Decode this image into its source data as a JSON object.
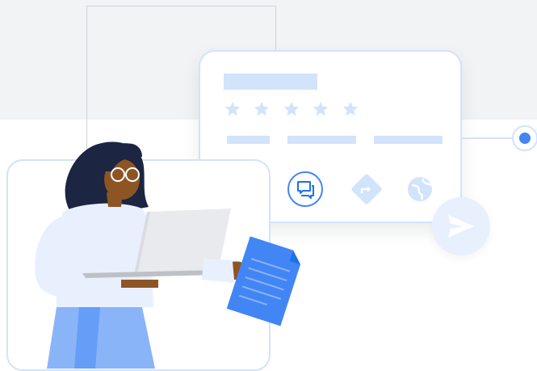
{
  "colors": {
    "accent": "#4285f4",
    "light_blue": "#d2e3fc",
    "pale_blue": "#e8f0fe",
    "background_band": "#f1f3f4"
  },
  "listing_card": {
    "rating": {
      "filled": 5,
      "max": 5
    },
    "actions": [
      {
        "icon": "chat-icon"
      },
      {
        "icon": "directions-icon"
      },
      {
        "icon": "globe-icon"
      }
    ]
  },
  "send_button": {
    "icon": "send-icon"
  },
  "status_dot": {
    "icon": "dot-icon"
  },
  "illustration": {
    "subject": "person-with-laptop-and-document"
  }
}
